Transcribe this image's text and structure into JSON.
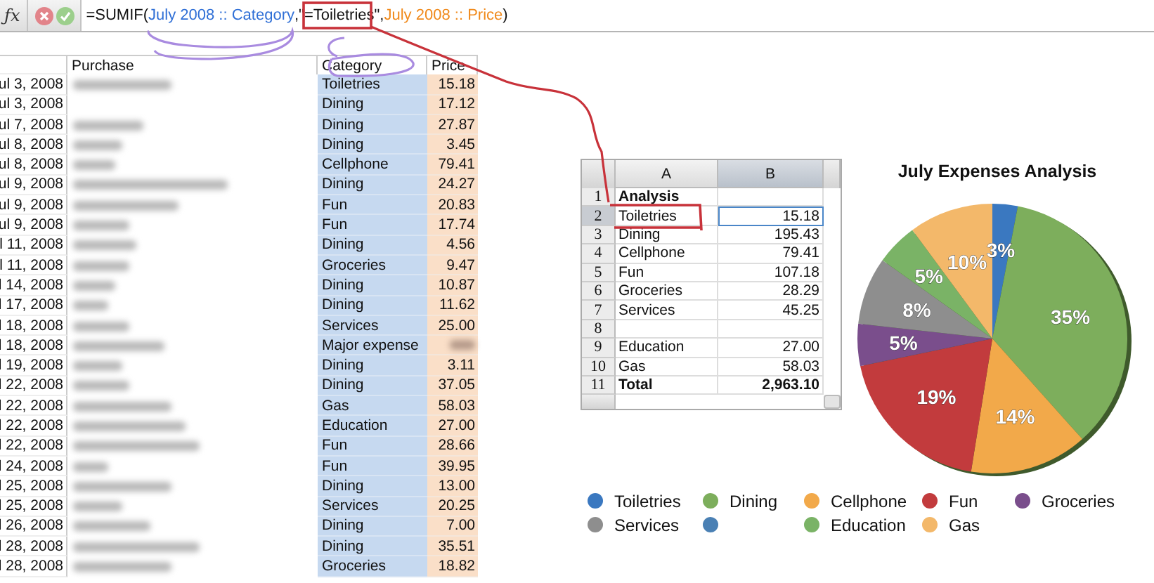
{
  "formula_bar": {
    "function_label": "ƒx",
    "parts": [
      {
        "text": "=SUMIF(",
        "kind": "plain"
      },
      {
        "text": "July 2008 :: Category",
        "kind": "ref",
        "color": "#2f6fd6"
      },
      {
        "text": ",\"=",
        "kind": "plain"
      },
      {
        "text": "Toiletries",
        "kind": "plain"
      },
      {
        "text": "\",",
        "kind": "plain"
      },
      {
        "text": "July 2008 :: Price",
        "kind": "ref",
        "color": "#f08a1c"
      },
      {
        "text": ")",
        "kind": "plain"
      }
    ]
  },
  "expense_table": {
    "columns": [
      "Purchase",
      "Category",
      "Price"
    ],
    "rows": [
      {
        "date": "ul 3, 2008",
        "purchase_blurred": true,
        "category": "Toiletries",
        "price": "15.18"
      },
      {
        "date": "ul 3, 2008",
        "purchase_blurred": false,
        "category": "Dining",
        "price": "17.12"
      },
      {
        "date": "ul 7, 2008",
        "purchase_blurred": true,
        "category": "Dining",
        "price": "27.87"
      },
      {
        "date": "ul 8, 2008",
        "purchase_blurred": true,
        "category": "Dining",
        "price": "3.45"
      },
      {
        "date": "ul 8, 2008",
        "purchase_blurred": true,
        "category": "Cellphone",
        "price": "79.41"
      },
      {
        "date": "ul 9, 2008",
        "purchase_blurred": true,
        "category": "Dining",
        "price": "24.27"
      },
      {
        "date": "ul 9, 2008",
        "purchase_blurred": true,
        "category": "Fun",
        "price": "20.83"
      },
      {
        "date": "ul 9, 2008",
        "purchase_blurred": true,
        "category": "Fun",
        "price": "17.74"
      },
      {
        "date": "l 11, 2008",
        "purchase_blurred": true,
        "category": "Dining",
        "price": "4.56"
      },
      {
        "date": "l 11, 2008",
        "purchase_blurred": true,
        "category": "Groceries",
        "price": "9.47"
      },
      {
        "date": "l 14, 2008",
        "purchase_blurred": true,
        "category": "Dining",
        "price": "10.87"
      },
      {
        "date": "l 17, 2008",
        "purchase_blurred": true,
        "category": "Dining",
        "price": "11.62"
      },
      {
        "date": "l 18, 2008",
        "purchase_blurred": true,
        "category": "Services",
        "price": "25.00"
      },
      {
        "date": "l 18, 2008",
        "purchase_blurred": true,
        "category": "Major expense"
      },
      {
        "date": "l 19, 2008",
        "purchase_blurred": true,
        "category": "Dining",
        "price": "3.11"
      },
      {
        "date": "l 22, 2008",
        "purchase_blurred": true,
        "category": "Dining",
        "price": "37.05"
      },
      {
        "date": "l 22, 2008",
        "purchase_blurred": true,
        "category": "Gas",
        "price": "58.03"
      },
      {
        "date": "l 22, 2008",
        "purchase_blurred": true,
        "category": "Education",
        "price": "27.00"
      },
      {
        "date": "l 22, 2008",
        "purchase_blurred": true,
        "category": "Fun",
        "price": "28.66"
      },
      {
        "date": "l 24, 2008",
        "purchase_blurred": true,
        "category": "Fun",
        "price": "39.95"
      },
      {
        "date": "l 25, 2008",
        "purchase_blurred": true,
        "category": "Dining",
        "price": "13.00"
      },
      {
        "date": "l 25, 2008",
        "purchase_blurred": true,
        "category": "Services",
        "price": "20.25"
      },
      {
        "date": "l 26, 2008",
        "purchase_blurred": true,
        "category": "Dining",
        "price": "7.00"
      },
      {
        "date": "l 28, 2008",
        "purchase_blurred": true,
        "category": "Dining",
        "price": "35.51"
      },
      {
        "date": "l 28, 2008",
        "purchase_blurred": true,
        "category": "Groceries",
        "price": "18.82"
      }
    ]
  },
  "analysis_table": {
    "columns": [
      "A",
      "B"
    ],
    "rows": [
      {
        "number": "1",
        "kind": "header",
        "label": "Analysis",
        "selected": false
      },
      {
        "number": "2",
        "kind": "item",
        "label": "Toiletries",
        "value": "15.18",
        "selected": true
      },
      {
        "number": "3",
        "kind": "item",
        "label": "Dining",
        "value": "195.43",
        "selected": false
      },
      {
        "number": "4",
        "kind": "item",
        "label": "Cellphone",
        "value": "79.41",
        "selected": false
      },
      {
        "number": "5",
        "kind": "item",
        "label": "Fun",
        "value": "107.18",
        "selected": false
      },
      {
        "number": "6",
        "kind": "item",
        "label": "Groceries",
        "value": "28.29",
        "selected": false
      },
      {
        "number": "7",
        "kind": "item",
        "label": "Services",
        "value": "45.25",
        "selected": false
      },
      {
        "number": "8",
        "kind": "blank",
        "selected": false
      },
      {
        "number": "9",
        "kind": "item",
        "label": "Education",
        "value": "27.00",
        "selected": false
      },
      {
        "number": "10",
        "kind": "item",
        "label": "Gas",
        "value": "58.03",
        "selected": false
      },
      {
        "number": "11",
        "kind": "total",
        "label": "Total",
        "value": "2,963.10",
        "selected": false
      }
    ]
  },
  "chart": {
    "chart_data": {
      "type": "pie",
      "title": "July Expenses Analysis",
      "categories": [
        "Toiletries",
        "Dining",
        "Cellphone",
        "Fun",
        "Groceries",
        "Services",
        null,
        "Education",
        "Gas"
      ],
      "colors": [
        "#3a78c0",
        "#7dae5c",
        "#f2a94a",
        "#c23b3d",
        "#7a4e8c",
        "#8e8e8e",
        "#4a80b4",
        "#7ab366",
        "#f3b86a"
      ],
      "data_labels": true,
      "values": [
        3,
        35,
        14,
        19,
        5,
        8,
        0,
        5,
        10
      ],
      "value_labels": [
        "3%",
        "35%",
        "14%",
        "19%",
        "5%",
        "8%",
        null,
        "5%",
        "10%"
      ]
    }
  }
}
